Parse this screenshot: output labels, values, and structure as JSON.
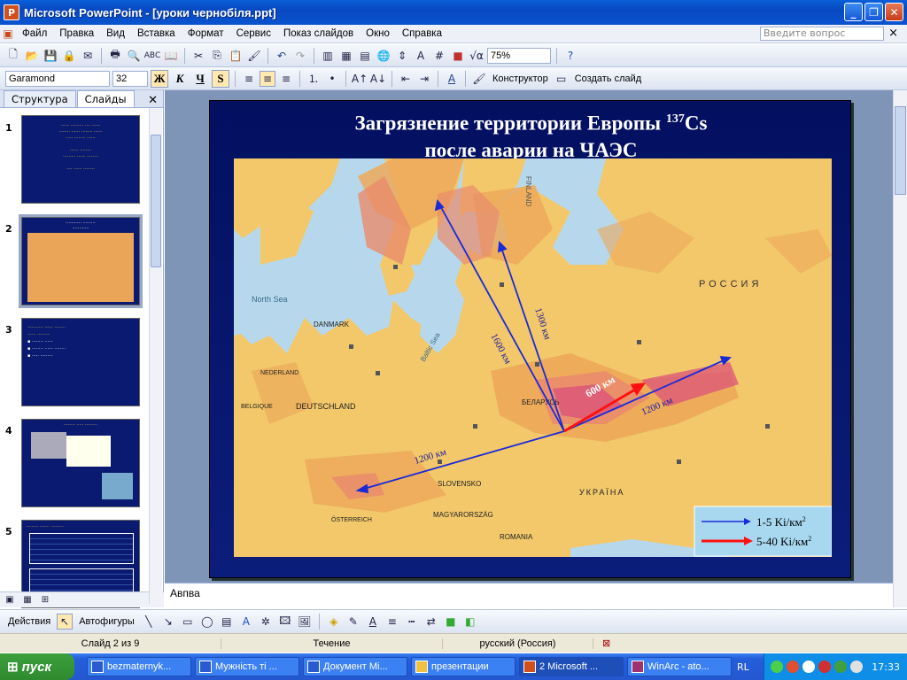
{
  "window": {
    "title": "Microsoft PowerPoint - [уроки чернобіля.ppt]",
    "app_icon": "P"
  },
  "menu": {
    "items": [
      "Файл",
      "Правка",
      "Вид",
      "Вставка",
      "Формат",
      "Сервис",
      "Показ слайдов",
      "Окно",
      "Справка"
    ],
    "ask_placeholder": "Введите вопрос"
  },
  "toolbar": {
    "zoom": "75%"
  },
  "format": {
    "font": "Garamond",
    "size": "32",
    "bold": "Ж",
    "italic": "К",
    "underline": "Ч",
    "shadow": "S",
    "designer": "Конструктор",
    "new_slide": "Создать слайд"
  },
  "panel": {
    "tab_outline": "Структура",
    "tab_slides": "Слайды",
    "slides": [
      "1",
      "2",
      "3",
      "4",
      "5"
    ]
  },
  "slide": {
    "title_line1": "Загрязнение территории Европы ",
    "title_sup": "137",
    "title_line1b": "Cs",
    "title_line2": "после аварии на ЧАЭС",
    "map_labels": {
      "north_sea": "North Sea",
      "denmark": "DANMARK",
      "deutschland": "DEUTSCHLAND",
      "belarus": "БЕЛАРУСЬ",
      "rossiya": "РОССИЯ",
      "ukraina": "УКРАЇНА",
      "slovensko": "SLOVENSKO",
      "magyarorszag": "MAGYARORSZÁG",
      "romania": "ROMANIA",
      "osterreich": "ÖSTERREICH",
      "finland": "FINLAND",
      "baltic": "Baltic Sea",
      "nederland": "NEDERLAND",
      "belgique": "BELGIQUE"
    },
    "distances": {
      "d1600": "1600 км",
      "d1300": "1300 км",
      "d600": "600 км",
      "d1200e": "1200 км",
      "d1200w": "1200 км"
    },
    "legend": {
      "blue": "1-5 Ki/км",
      "red": "5-40 Ki/км",
      "sup": "2"
    }
  },
  "notes": "Авпва",
  "drawbar": {
    "actions": "Действия",
    "autoshapes": "Автофигуры"
  },
  "status": {
    "slide": "Слайд 2 из 9",
    "design": "Течение",
    "lang": "русский (Россия)"
  },
  "taskbar": {
    "start": "пуск",
    "tasks": [
      "bezmaternyk...",
      "Мужність ті ...",
      "Документ Mi...",
      "презентации",
      "2 Microsoft ...",
      "WinArc - ato..."
    ],
    "lang": "RL",
    "time": "17:33"
  },
  "colors": {
    "land": "#f2c86a",
    "contam_light": "#eda95a",
    "contam_mid": "#e98c6c",
    "contam_high": "#dd5a78",
    "sea": "#b7d8ec",
    "blue_arrow": "#1a2ad8",
    "red_arrow": "#ff1010"
  }
}
